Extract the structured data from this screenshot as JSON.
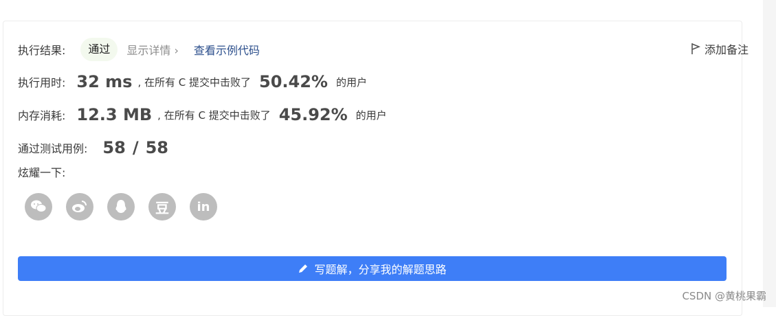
{
  "result": {
    "label": "执行结果:",
    "status": "通过",
    "details_link": "显示详情 ›",
    "example_link": "查看示例代码"
  },
  "note": {
    "label": "添加备注",
    "icon": "flag-icon"
  },
  "runtime": {
    "label": "执行用时:",
    "value": "32 ms",
    "mid_text": ", 在所有 C 提交中击败了",
    "percent": "50.42%",
    "suffix": "的用户"
  },
  "memory": {
    "label": "内存消耗:",
    "value": "12.3 MB",
    "mid_text": ", 在所有 C 提交中击败了",
    "percent": "45.92%",
    "suffix": "的用户"
  },
  "tests": {
    "label": "通过测试用例:",
    "passed": "58",
    "separator": "/",
    "total": "58"
  },
  "share": {
    "label": "炫耀一下:",
    "icons": [
      "wechat-icon",
      "weibo-icon",
      "qq-icon",
      "douban-icon",
      "linkedin-icon"
    ],
    "douban_glyph": "豆",
    "linkedin_glyph": "in"
  },
  "cta": {
    "label": "写题解，分享我的解题思路",
    "icon": "pencil-icon",
    "color": "#3e7ef7"
  },
  "watermark": "CSDN @黄桃果霸"
}
